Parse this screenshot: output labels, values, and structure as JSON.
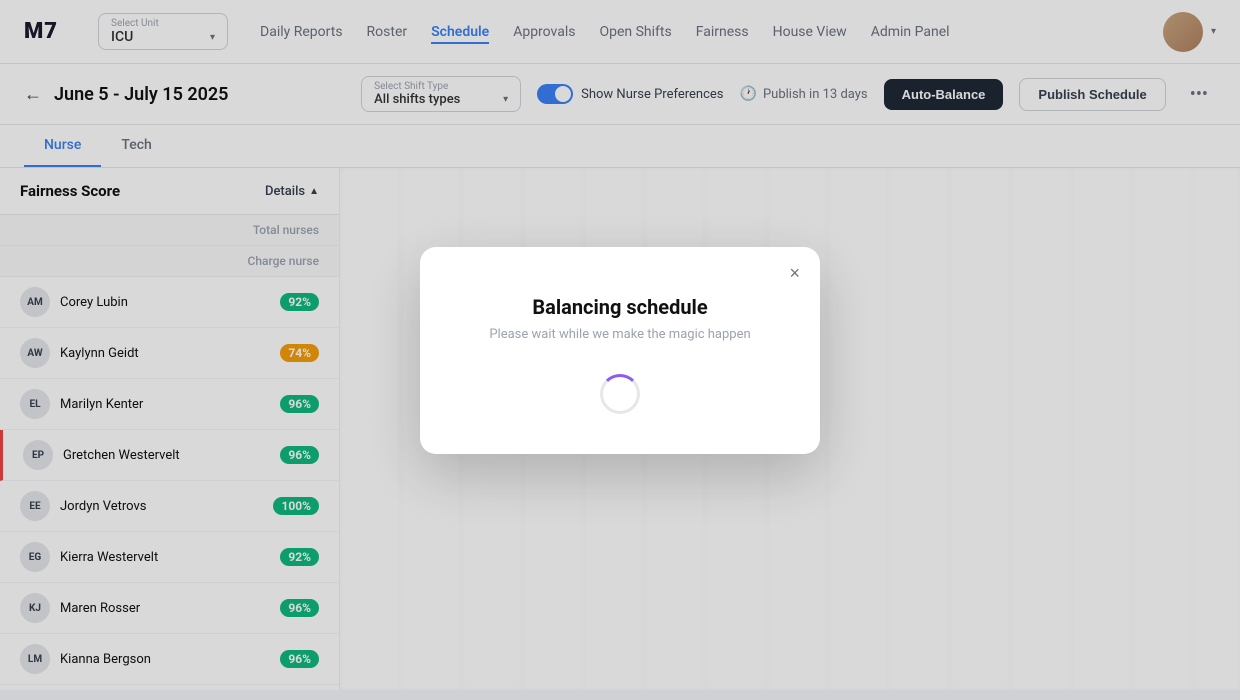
{
  "app": {
    "logo": "M7"
  },
  "topnav": {
    "unit_label": "Select Unit",
    "unit_value": "ICU",
    "links": [
      {
        "id": "daily-reports",
        "label": "Daily Reports"
      },
      {
        "id": "roster",
        "label": "Roster"
      },
      {
        "id": "schedule",
        "label": "Schedule",
        "active": true
      },
      {
        "id": "approvals",
        "label": "Approvals"
      },
      {
        "id": "open-shifts",
        "label": "Open Shifts"
      },
      {
        "id": "fairness",
        "label": "Fairness"
      },
      {
        "id": "house-view",
        "label": "House View"
      },
      {
        "id": "admin-panel",
        "label": "Admin Panel"
      }
    ]
  },
  "toolbar": {
    "back_arrow": "←",
    "date_range": "June 5 - July 15 2025",
    "shift_type_label": "Select Shift Type",
    "shift_type_value": "All shifts types",
    "show_nurse_preferences": "Show Nurse Preferences",
    "publish_info": "Publish in 13 days",
    "auto_balance_btn": "Auto-Balance",
    "publish_schedule_btn": "Publish Schedule",
    "more_icon": "•••"
  },
  "tabs": [
    {
      "id": "nurse",
      "label": "Nurse",
      "active": true
    },
    {
      "id": "tech",
      "label": "Tech"
    }
  ],
  "sidebar": {
    "title": "Fairness Score",
    "details_label": "Details",
    "subheaders": [
      "Total nurses",
      "Charge nurse"
    ],
    "nurses": [
      {
        "initials": "AM",
        "name": "Corey Lubin",
        "score": "92%",
        "level": "high"
      },
      {
        "initials": "AW",
        "name": "Kaylynn Geidt",
        "score": "74%",
        "level": "med"
      },
      {
        "initials": "EL",
        "name": "Marilyn Kenter",
        "score": "96%",
        "level": "high"
      },
      {
        "initials": "EP",
        "name": "Gretchen Westervelt",
        "score": "96%",
        "level": "high",
        "highlighted": true
      },
      {
        "initials": "EE",
        "name": "Jordyn Vetrovs",
        "score": "100%",
        "level": "perfect"
      },
      {
        "initials": "EG",
        "name": "Kierra Westervelt",
        "score": "92%",
        "level": "high"
      },
      {
        "initials": "KJ",
        "name": "Maren Rosser",
        "score": "96%",
        "level": "high"
      },
      {
        "initials": "LM",
        "name": "Kianna Bergson",
        "score": "96%",
        "level": "high"
      }
    ]
  },
  "modal": {
    "title": "Balancing schedule",
    "subtitle": "Please wait while we make the magic happen",
    "close_icon": "×"
  }
}
